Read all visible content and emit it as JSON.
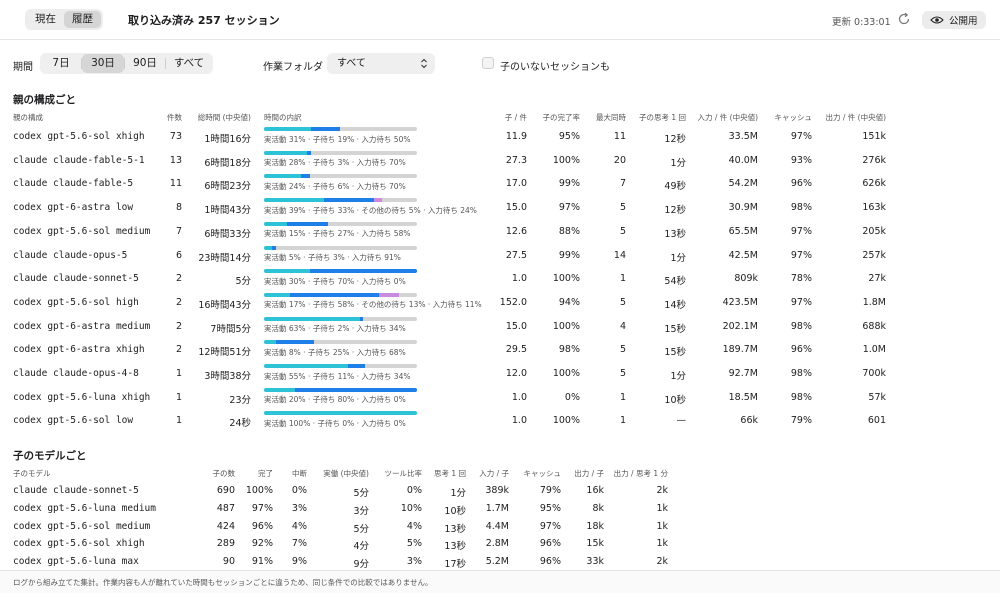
{
  "topbar": {
    "tabs": [
      {
        "label": "現在",
        "active": false
      },
      {
        "label": "履歴",
        "active": true
      }
    ],
    "title": "取り込み済み 257 セッション",
    "updated": "更新 0:33:01",
    "public_label": "公開用"
  },
  "filters": {
    "period_label": "期間",
    "periods": [
      {
        "label": "7日",
        "active": false
      },
      {
        "label": "30日",
        "active": true
      },
      {
        "label": "90日",
        "active": false
      },
      {
        "label": "すべて",
        "active": false
      }
    ],
    "folder_label": "作業フォルダ",
    "folder_value": "すべて",
    "childless_label": "子のいないセッションも",
    "childless_checked": false
  },
  "colors": {
    "active": "#2ec2d6",
    "child": "#1e7fe8",
    "other": "#c98be0",
    "input": "#57d36d",
    "track": "#d4d4d4"
  },
  "parents": {
    "title": "親の構成ごと",
    "headers": [
      "親の構成",
      "件数",
      "総時間 (中央値)",
      "時間の内訳",
      "子 / 件",
      "子の完了率",
      "最大同時",
      "子の思考 1 回",
      "入力 / 件 (中央値)",
      "キャッシュ",
      "出力 / 件 (中央値)"
    ],
    "rows": [
      {
        "name": "codex gpt-5.6-sol xhigh",
        "count": "73",
        "total": "1時間16分",
        "caption": "実活動 31% · 子待ち 19% · 入力待ち 50%",
        "bar": [
          [
            "active",
            31
          ],
          [
            "child",
            19
          ],
          [
            "other",
            0
          ],
          [
            "input",
            0
          ]
        ],
        "per": "11.9",
        "rate": "95%",
        "max": "11",
        "think": "12秒",
        "in": "33.5M",
        "cache": "97%",
        "out": "151k"
      },
      {
        "name": "claude claude-fable-5-1",
        "count": "13",
        "total": "6時間18分",
        "caption": "実活動 28% · 子待ち 3% · 入力待ち 70%",
        "bar": [
          [
            "active",
            28
          ],
          [
            "child",
            3
          ],
          [
            "other",
            0
          ],
          [
            "input",
            0
          ]
        ],
        "per": "27.3",
        "rate": "100%",
        "max": "20",
        "think": "1分",
        "in": "40.0M",
        "cache": "93%",
        "out": "276k"
      },
      {
        "name": "claude claude-fable-5",
        "count": "11",
        "total": "6時間23分",
        "caption": "実活動 24% · 子待ち 6% · 入力待ち 70%",
        "bar": [
          [
            "active",
            24
          ],
          [
            "child",
            6
          ],
          [
            "other",
            0
          ],
          [
            "input",
            0
          ]
        ],
        "per": "17.0",
        "rate": "99%",
        "max": "7",
        "think": "49秒",
        "in": "54.2M",
        "cache": "96%",
        "out": "626k"
      },
      {
        "name": "codex gpt-6-astra low",
        "count": "8",
        "total": "1時間43分",
        "caption": "実活動 39% · 子待ち 33% · その他の待ち 5% · 入力待ち 24%",
        "bar": [
          [
            "active",
            39
          ],
          [
            "child",
            33
          ],
          [
            "other",
            5
          ],
          [
            "input",
            0
          ]
        ],
        "per": "15.0",
        "rate": "97%",
        "max": "5",
        "think": "12秒",
        "in": "30.9M",
        "cache": "98%",
        "out": "163k"
      },
      {
        "name": "codex gpt-5.6-sol medium",
        "count": "7",
        "total": "6時間33分",
        "caption": "実活動 15% · 子待ち 27% · 入力待ち 58%",
        "bar": [
          [
            "active",
            15
          ],
          [
            "child",
            27
          ],
          [
            "other",
            0
          ],
          [
            "input",
            0
          ]
        ],
        "per": "12.6",
        "rate": "88%",
        "max": "5",
        "think": "13秒",
        "in": "65.5M",
        "cache": "97%",
        "out": "205k"
      },
      {
        "name": "claude claude-opus-5",
        "count": "6",
        "total": "23時間14分",
        "caption": "実活動 5% · 子待ち 3% · 入力待ち 91%",
        "bar": [
          [
            "active",
            5
          ],
          [
            "child",
            3
          ],
          [
            "other",
            0
          ],
          [
            "input",
            0
          ]
        ],
        "per": "27.5",
        "rate": "99%",
        "max": "14",
        "think": "1分",
        "in": "42.5M",
        "cache": "97%",
        "out": "257k"
      },
      {
        "name": "claude claude-sonnet-5",
        "count": "2",
        "total": "5分",
        "caption": "実活動 30% · 子待ち 70% · 入力待ち 0%",
        "bar": [
          [
            "active",
            30
          ],
          [
            "child",
            70
          ],
          [
            "other",
            0
          ],
          [
            "input",
            0
          ]
        ],
        "per": "1.0",
        "rate": "100%",
        "max": "1",
        "think": "54秒",
        "in": "809k",
        "cache": "78%",
        "out": "27k"
      },
      {
        "name": "codex gpt-5.6-sol high",
        "count": "2",
        "total": "16時間43分",
        "caption": "実活動 17% · 子待ち 58% · その他の待ち 13% · 入力待ち 11%",
        "bar": [
          [
            "active",
            17
          ],
          [
            "child",
            58
          ],
          [
            "other",
            13
          ],
          [
            "input",
            0
          ]
        ],
        "per": "152.0",
        "rate": "94%",
        "max": "5",
        "think": "14秒",
        "in": "423.5M",
        "cache": "97%",
        "out": "1.8M"
      },
      {
        "name": "codex gpt-6-astra medium",
        "count": "2",
        "total": "7時間5分",
        "caption": "実活動 63% · 子待ち 2% · 入力待ち 34%",
        "bar": [
          [
            "active",
            63
          ],
          [
            "child",
            2
          ],
          [
            "other",
            0
          ],
          [
            "input",
            0
          ]
        ],
        "per": "15.0",
        "rate": "100%",
        "max": "4",
        "think": "15秒",
        "in": "202.1M",
        "cache": "98%",
        "out": "688k"
      },
      {
        "name": "codex gpt-6-astra xhigh",
        "count": "2",
        "total": "12時間51分",
        "caption": "実活動 8% · 子待ち 25% · 入力待ち 68%",
        "bar": [
          [
            "active",
            8
          ],
          [
            "child",
            25
          ],
          [
            "other",
            0
          ],
          [
            "input",
            0
          ]
        ],
        "per": "29.5",
        "rate": "98%",
        "max": "5",
        "think": "15秒",
        "in": "189.7M",
        "cache": "96%",
        "out": "1.0M"
      },
      {
        "name": "claude claude-opus-4-8",
        "count": "1",
        "total": "3時間38分",
        "caption": "実活動 55% · 子待ち 11% · 入力待ち 34%",
        "bar": [
          [
            "active",
            55
          ],
          [
            "child",
            11
          ],
          [
            "other",
            0
          ],
          [
            "input",
            0
          ]
        ],
        "per": "12.0",
        "rate": "100%",
        "max": "5",
        "think": "1分",
        "in": "92.7M",
        "cache": "98%",
        "out": "700k"
      },
      {
        "name": "codex gpt-5.6-luna xhigh",
        "count": "1",
        "total": "23分",
        "caption": "実活動 20% · 子待ち 80% · 入力待ち 0%",
        "bar": [
          [
            "active",
            20
          ],
          [
            "child",
            80
          ],
          [
            "other",
            0
          ],
          [
            "input",
            0
          ]
        ],
        "per": "1.0",
        "rate": "0%",
        "max": "1",
        "think": "10秒",
        "in": "18.5M",
        "cache": "98%",
        "out": "57k"
      },
      {
        "name": "codex gpt-5.6-sol low",
        "count": "1",
        "total": "24秒",
        "caption": "実活動 100% · 子待ち 0% · 入力待ち 0%",
        "bar": [
          [
            "active",
            100
          ],
          [
            "child",
            0
          ],
          [
            "other",
            0
          ],
          [
            "input",
            0
          ]
        ],
        "per": "1.0",
        "rate": "100%",
        "max": "1",
        "think": "—",
        "in": "66k",
        "cache": "79%",
        "out": "601"
      }
    ]
  },
  "children": {
    "title": "子のモデルごと",
    "headers": [
      "子のモデル",
      "子の数",
      "完了",
      "中断",
      "実働 (中央値)",
      "ツール比率",
      "思考 1 回",
      "入力 / 子",
      "キャッシュ",
      "出力 / 子",
      "出力 / 思考 1 分"
    ],
    "rows": [
      {
        "name": "claude claude-sonnet-5",
        "n": "690",
        "done": "100%",
        "abort": "0%",
        "work": "5分",
        "tool": "0%",
        "think": "1分",
        "in": "389k",
        "cache": "79%",
        "out": "16k",
        "opm": "2k"
      },
      {
        "name": "codex gpt-5.6-luna medium",
        "n": "487",
        "done": "97%",
        "abort": "3%",
        "work": "3分",
        "tool": "10%",
        "think": "10秒",
        "in": "1.7M",
        "cache": "95%",
        "out": "8k",
        "opm": "1k"
      },
      {
        "name": "codex gpt-5.6-sol medium",
        "n": "424",
        "done": "96%",
        "abort": "4%",
        "work": "5分",
        "tool": "4%",
        "think": "13秒",
        "in": "4.4M",
        "cache": "97%",
        "out": "18k",
        "opm": "1k"
      },
      {
        "name": "codex gpt-5.6-sol xhigh",
        "n": "289",
        "done": "92%",
        "abort": "7%",
        "work": "4分",
        "tool": "5%",
        "think": "13秒",
        "in": "2.8M",
        "cache": "96%",
        "out": "15k",
        "opm": "1k"
      },
      {
        "name": "codex gpt-5.6-luna max",
        "n": "90",
        "done": "91%",
        "abort": "9%",
        "work": "9分",
        "tool": "3%",
        "think": "17秒",
        "in": "5.2M",
        "cache": "96%",
        "out": "33k",
        "opm": "2k"
      }
    ]
  },
  "footer": "ログから組み立てた集計。作業内容も人が離れていた時間もセッションごとに違うため、同じ条件での比較ではありません。"
}
